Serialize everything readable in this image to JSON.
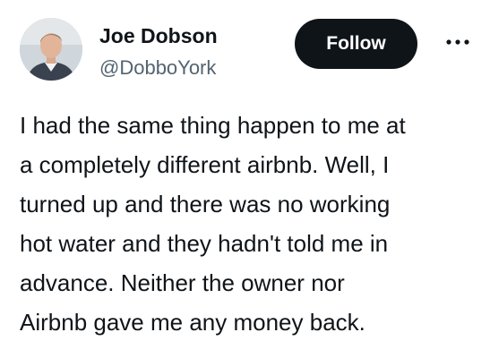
{
  "author": {
    "name": "Joe Dobson",
    "handle": "@DobboYork",
    "avatar_icon": "user-photo"
  },
  "actions": {
    "follow_label": "Follow",
    "more_icon": "more-dots-icon"
  },
  "tweet": {
    "text": "I had the same thing happen to me at\na completely different airbnb.  Well, I\nturned up and there was no working\nhot water and they hadn't told me in\nadvance. Neither the owner nor\nAirbnb gave me any money back."
  },
  "colors": {
    "text_primary": "#0f1419",
    "text_secondary": "#536471",
    "button_bg": "#0f1419",
    "button_text": "#ffffff",
    "background": "#ffffff"
  }
}
